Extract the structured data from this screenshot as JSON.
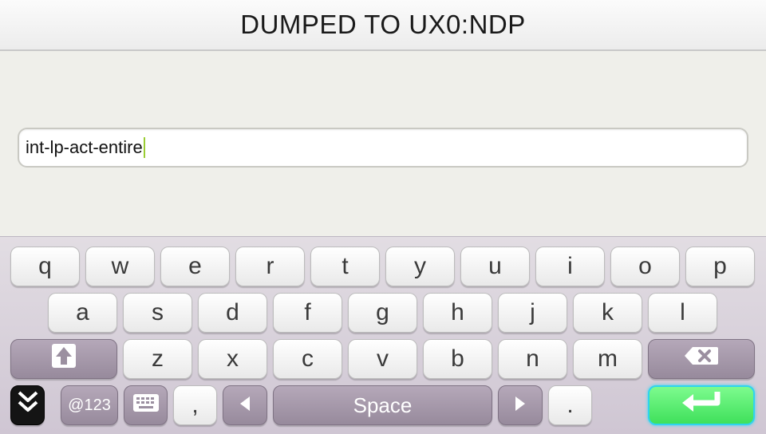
{
  "header": {
    "title": "DUMPED TO UX0:NDP"
  },
  "input": {
    "value": "int-lp-act-entire"
  },
  "keyboard": {
    "row1": [
      "q",
      "w",
      "e",
      "r",
      "t",
      "y",
      "u",
      "i",
      "o",
      "p"
    ],
    "row2": [
      "a",
      "s",
      "d",
      "f",
      "g",
      "h",
      "j",
      "k",
      "l"
    ],
    "row3": [
      "z",
      "x",
      "c",
      "v",
      "b",
      "n",
      "m"
    ],
    "symbols_label": "@123",
    "comma_label": ",",
    "space_label": "Space",
    "period_label": ".",
    "icons": {
      "shift": "shift-up-arrow-icon",
      "backspace": "backspace-icon",
      "hide": "hide-keyboard-icon",
      "layout": "keyboard-layout-icon",
      "cursor_left": "left-arrow-icon",
      "cursor_right": "right-arrow-icon",
      "enter": "enter-return-icon"
    },
    "colors": {
      "enter_key": "#5cf07a",
      "enter_glow": "#34d8f4",
      "function_key": "#a597aa",
      "caret": "#9acd32"
    }
  }
}
